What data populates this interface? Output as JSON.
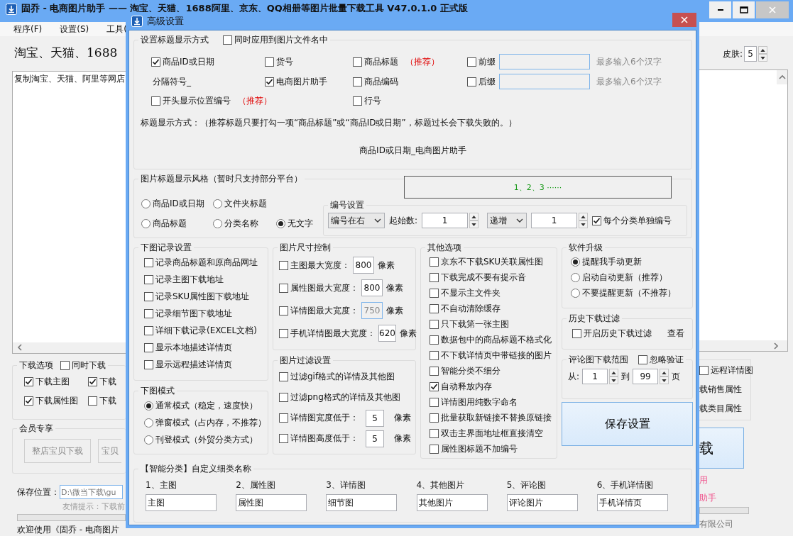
{
  "main_window": {
    "title": "固乔 - 电商图片助手 —— 淘宝、天猫、1688阿里、京东、QQ相册等图片批量下载工具 V47.0.1.0 正式版",
    "menu": [
      "程序(F)",
      "设置(S)",
      "工具("
    ],
    "heading": "淘宝、天猫、1688",
    "link_input": {
      "value": "复制淘宝、天猫、阿里等网店"
    },
    "download_options": {
      "title": "下载选项",
      "also_download": {
        "label": "同时下载",
        "checked": false
      },
      "items": [
        {
          "label": "下载主图",
          "checked": true
        },
        {
          "label": "下载",
          "checked": true
        },
        {
          "label": "下载属性图",
          "checked": true
        },
        {
          "label": "下载",
          "checked": false
        }
      ]
    },
    "member": {
      "title": "会员专享",
      "buttons": [
        "整店宝贝下载",
        "宝贝"
      ]
    },
    "save_location": {
      "label": "保存位置：",
      "value": "D:\\微当下载\\gu"
    },
    "tip": "友情提示：下载前",
    "progress": {
      "level": 0
    },
    "status": "欢迎使用《固乔 - 电商图片",
    "skin": {
      "label": "皮肤:",
      "value": "5"
    },
    "remote_detail": {
      "label": "远程详情图",
      "checked": false
    },
    "right_texts": [
      "载销售属性",
      "载类目属性"
    ],
    "download_button": "载",
    "notes": [
      "用",
      "助手"
    ],
    "right_progress": {
      "level": 0
    },
    "company": "有限公司"
  },
  "dialog": {
    "title": "高级设置",
    "title_format": {
      "title": "设置标题显示方式",
      "apply_to_filename": {
        "label": "同时应用到图片文件名中",
        "checked": false
      },
      "options": [
        {
          "label": "商品ID或日期",
          "checked": true
        },
        {
          "label": "货号",
          "checked": false
        },
        {
          "label": "商品标题",
          "checked": false,
          "note": "（推荐）"
        },
        {
          "label": "电商图片助手",
          "checked": true
        },
        {
          "label": "商品编码",
          "checked": false
        },
        {
          "label": "开头显示位置编号",
          "checked": false,
          "note": "（推荐）"
        },
        {
          "label": "行号",
          "checked": false
        }
      ],
      "separator": "分隔符号_",
      "affixes": [
        {
          "label": "前缀",
          "checked": false,
          "hint": "最多输入6个汉字"
        },
        {
          "label": "后缀",
          "checked": false,
          "hint": "最多输入6个汉字"
        }
      ],
      "explanation": "标题显示方式：（推荐标题只要打勾一项“商品标题”或“商品ID或日期”，标题过长会下载失败的。）",
      "preview": "商品ID或日期_电商图片助手"
    },
    "title_style": {
      "title": "图片标题显示风格（暂时只支持部分平台）",
      "options": [
        {
          "label": "商品ID或日期",
          "selected": false
        },
        {
          "label": "文件夹标题",
          "selected": false
        },
        {
          "label": "商品标题",
          "selected": false
        },
        {
          "label": "分类名称",
          "selected": false
        },
        {
          "label": "无文字",
          "selected": true
        }
      ],
      "sample": "1、2、3 ······",
      "numbering": {
        "title": "编号设置",
        "position": "编号在右",
        "start_label": "起始数:",
        "start": "1",
        "direction": "递增",
        "step": "1",
        "per_category": {
          "label": "每个分类单独编号",
          "checked": true
        }
      }
    },
    "record_settings": {
      "title": "下图记录设置",
      "options": [
        {
          "label": "记录商品标题和原商品网址",
          "checked": false
        },
        {
          "label": "记录主图下载地址",
          "checked": false
        },
        {
          "label": "记录SKU属性图下载地址",
          "checked": false
        },
        {
          "label": "记录细节图下载地址",
          "checked": false
        },
        {
          "label": "详细下载记录(EXCEL文档)",
          "checked": false
        },
        {
          "label": "显示本地描述详情页",
          "checked": false
        },
        {
          "label": "显示远程描述详情页",
          "checked": false
        }
      ]
    },
    "download_mode": {
      "title": "下图模式",
      "options": [
        {
          "label": "通常模式（稳定，速度快）",
          "selected": true
        },
        {
          "label": "弹窗模式（占内存，不推荐）",
          "selected": false
        },
        {
          "label": "刊登模式（外贸分类方式）",
          "selected": false
        }
      ]
    },
    "size_control": {
      "title": "图片尺寸控制",
      "rows": [
        {
          "label": "主图最大宽度：",
          "checked": false,
          "value": "800",
          "disabled": false,
          "unit": "像素"
        },
        {
          "label": "属性图最大宽度：",
          "checked": false,
          "value": "800",
          "disabled": false,
          "unit": "像素"
        },
        {
          "label": "详情图最大宽度：",
          "checked": false,
          "value": "750",
          "disabled": true,
          "unit": "像素"
        },
        {
          "label": "手机详情图最大宽度：",
          "checked": false,
          "value": "620",
          "disabled": false,
          "unit": "像素"
        }
      ]
    },
    "filter": {
      "title": "图片过滤设置",
      "rows": [
        {
          "kind": "check",
          "label": "过滤gif格式的详情及其他图",
          "checked": false
        },
        {
          "kind": "check",
          "label": "过滤png格式的详情及其他图",
          "checked": false
        },
        {
          "kind": "threshold",
          "label": "详情图宽度低于：",
          "checked": false,
          "value": "5",
          "unit": "像素"
        },
        {
          "kind": "threshold",
          "label": "详情图高度低于：",
          "checked": false,
          "value": "5",
          "unit": "像素"
        }
      ]
    },
    "other_options": {
      "title": "其他选项",
      "options": [
        {
          "label": "京东不下载SKU关联属性图",
          "checked": false
        },
        {
          "label": "下载完成不要有提示音",
          "checked": false
        },
        {
          "label": "不显示主文件夹",
          "checked": false
        },
        {
          "label": "不自动清除缓存",
          "checked": false
        },
        {
          "label": "只下载第一张主图",
          "checked": false
        },
        {
          "label": "数据包中的商品标题不格式化",
          "checked": false
        },
        {
          "label": "不下载详情页中带链接的图片",
          "checked": false
        },
        {
          "label": "智能分类不细分",
          "checked": false
        },
        {
          "label": "自动释放内存",
          "checked": true
        },
        {
          "label": "详情图用纯数字命名",
          "checked": false
        },
        {
          "label": "批量获取新链接不替换原链接",
          "checked": false
        },
        {
          "label": "双击主界面地址框直接清空",
          "checked": false
        },
        {
          "label": "属性图标题不加编号",
          "checked": false
        }
      ]
    },
    "upgrade": {
      "title": "软件升级",
      "options": [
        {
          "label": "提醒我手动更新",
          "selected": true
        },
        {
          "label": "启动自动更新（推荐）",
          "selected": false
        },
        {
          "label": "不要提醒更新（不推荐）",
          "selected": false
        }
      ]
    },
    "history_filter": {
      "title": "历史下载过滤",
      "option": {
        "label": "开启历史下载过滤",
        "checked": false
      },
      "link": "查看"
    },
    "comment_range": {
      "title": "评论图下载范围",
      "ignore": {
        "label": "忽略验证",
        "checked": false
      },
      "from_label": "从:",
      "from": "1",
      "to_label": "到",
      "to": "99",
      "unit": "页"
    },
    "save_button": "保存设置",
    "categories": {
      "title": "【智能分类】自定义细类名称",
      "items": [
        {
          "label": "1、主图",
          "value": "主图"
        },
        {
          "label": "2、属性图",
          "value": "属性图"
        },
        {
          "label": "3、详情图",
          "value": "细节图"
        },
        {
          "label": "4、其他图片",
          "value": "其他图片"
        },
        {
          "label": "5、评论图",
          "value": "评论图片"
        },
        {
          "label": "6、手机详情图",
          "value": "手机详情页"
        }
      ]
    }
  }
}
